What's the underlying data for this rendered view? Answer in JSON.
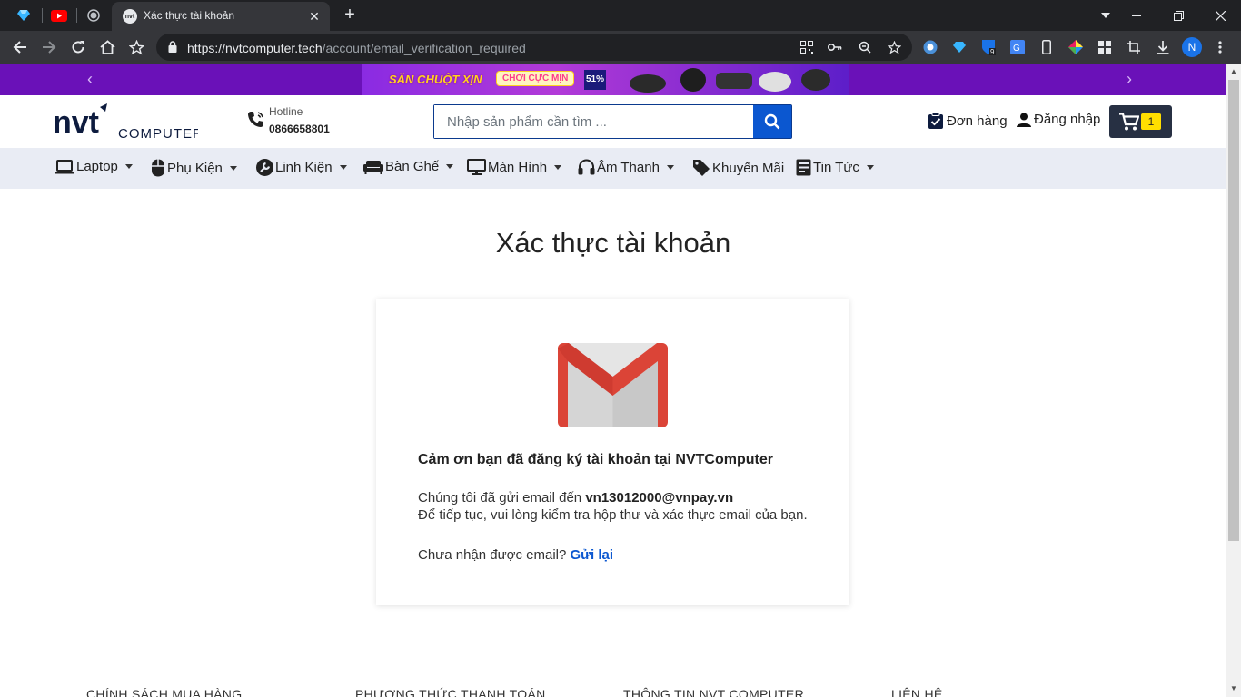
{
  "browser": {
    "tab_title": "Xác thực tài khoản",
    "tab_favicon_text": "nvt",
    "url_host": "https://nvtcomputer.tech",
    "url_path": "/account/email_verification_required",
    "profile_initial": "N",
    "ext_badge": "9"
  },
  "banner": {
    "text": "SĂN CHUỘT XỊN",
    "pill": "CHƠI CỰC MỊN",
    "percent": "51%"
  },
  "header": {
    "logo_main": "nvt",
    "logo_sub": "COMPUTER",
    "hotline_label": "Hotline",
    "hotline_number": "0866658801",
    "search_placeholder": "Nhập sản phẩm cần tìm ...",
    "orders_label": "Đơn hàng",
    "login_label": "Đăng nhập",
    "cart_count": "1"
  },
  "menu": [
    {
      "label": "Laptop",
      "icon": "laptop-icon",
      "dropdown": true
    },
    {
      "label": "Phụ Kiện",
      "icon": "mouse-icon",
      "dropdown": true
    },
    {
      "label": "Linh Kiện",
      "icon": "wrench-icon",
      "dropdown": true
    },
    {
      "label": "Bàn Ghế",
      "icon": "couch-icon",
      "dropdown": true
    },
    {
      "label": "Màn Hình",
      "icon": "monitor-icon",
      "dropdown": true
    },
    {
      "label": "Âm Thanh",
      "icon": "headphones-icon",
      "dropdown": true
    },
    {
      "label": "Khuyến Mãi",
      "icon": "tag-icon",
      "dropdown": false
    },
    {
      "label": "Tin Tức",
      "icon": "newspaper-icon",
      "dropdown": true
    }
  ],
  "main": {
    "title": "Xác thực tài khoản",
    "card_heading": "Cảm ơn bạn đã đăng ký tài khoản tại NVTComputer",
    "sent_prefix": "Chúng tôi đã gửi email đến ",
    "email": "vn13012000@vnpay.vn",
    "instruction": "Để tiếp tục, vui lòng kiểm tra hộp thư và xác thực email của bạn.",
    "not_received": "Chưa nhận được email?",
    "resend_label": "Gửi lại"
  },
  "footer": {
    "columns": [
      "CHÍNH SÁCH MUA HÀNG",
      "PHƯƠNG THỨC THANH TOÁN",
      "THÔNG TIN NVT COMPUTER",
      "LIÊN HỆ"
    ]
  },
  "colors": {
    "banner_purple": "#6a11b8",
    "primary_blue": "#0b57d0",
    "menu_bg": "#e9ecf4",
    "cart_bg": "#273043",
    "cart_badge": "#ffde00",
    "gmail_red": "#db4437"
  }
}
